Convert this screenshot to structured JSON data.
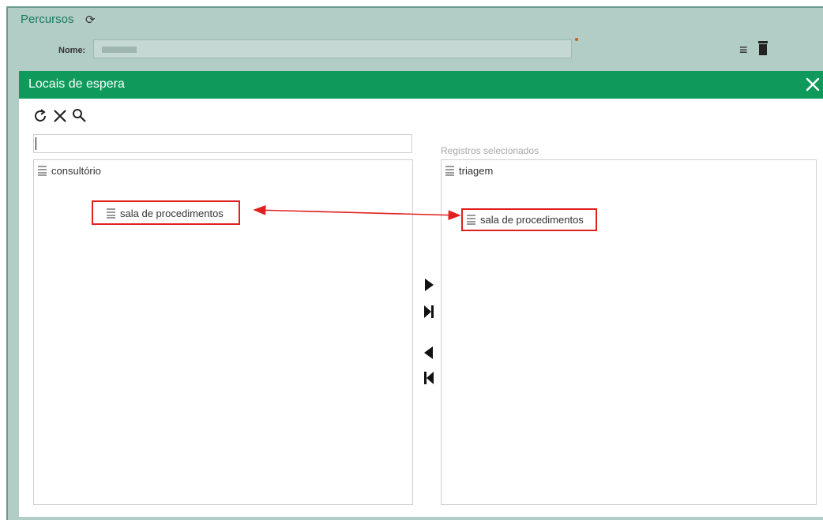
{
  "background": {
    "title": "Percursos",
    "name_label": "Nome:",
    "icons": [
      "refresh-icon",
      "menu-icon",
      "trash-icon"
    ]
  },
  "modal": {
    "title": "Locais de espera",
    "toolbar": [
      "refresh-icon",
      "clear-icon",
      "search-icon"
    ],
    "search": {
      "value": "",
      "placeholder": ""
    },
    "selected_label": "Registros selecionados",
    "available_items": [
      "consultório",
      "sala de procedimentos"
    ],
    "selected_items": [
      "triagem",
      "sala de procedimentos"
    ],
    "transfer_buttons": [
      "move-right",
      "move-all-right",
      "move-left",
      "move-all-left"
    ],
    "colors": {
      "header": "#0f9a5c",
      "highlight": "#e02020",
      "background_panel": "#b2ccc6"
    }
  }
}
